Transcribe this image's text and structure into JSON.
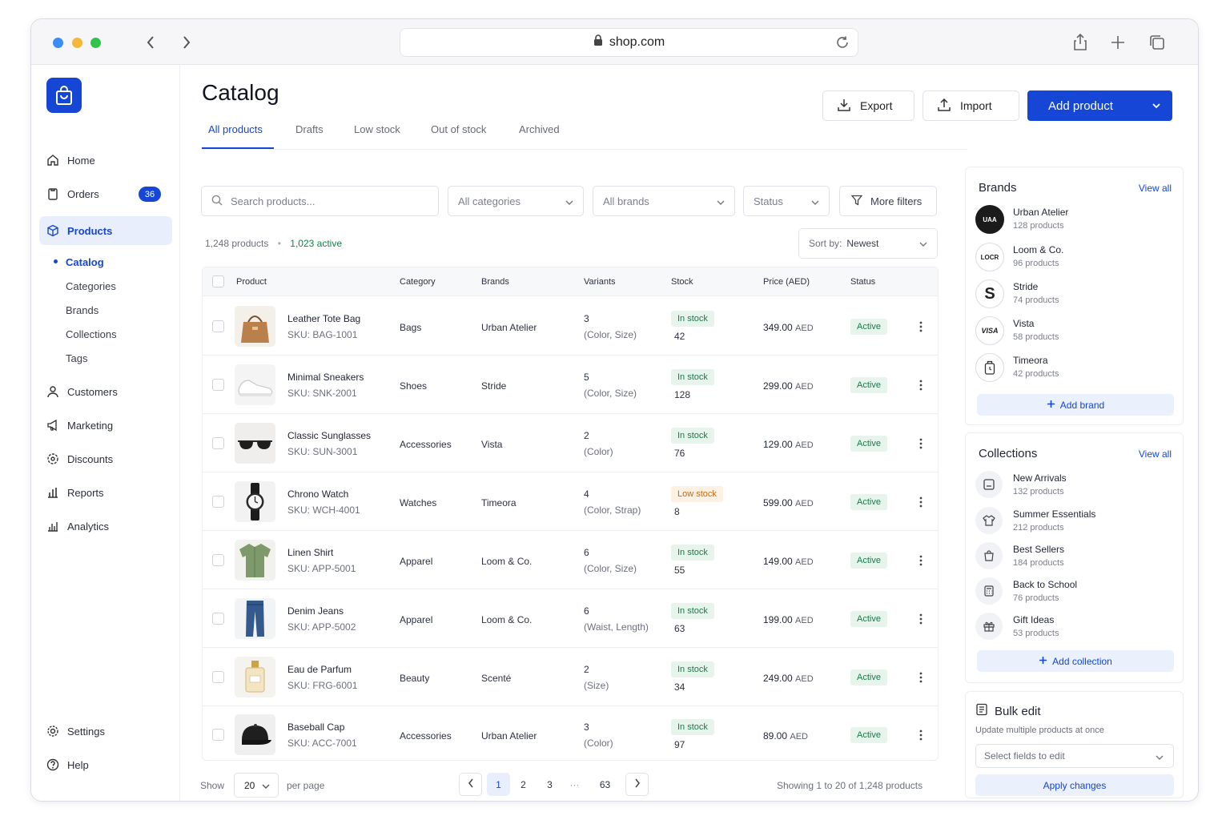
{
  "browser": {
    "url": "shop.com"
  },
  "colors": {
    "accent": "#1546d6",
    "success": "#1a7a48",
    "warning": "#c76a12"
  },
  "sidebar": {
    "nav": [
      {
        "label": "Home",
        "icon": "home-icon"
      },
      {
        "label": "Orders",
        "icon": "clipboard-icon",
        "badge": "36"
      },
      {
        "label": "Products",
        "icon": "box-icon",
        "active": true
      },
      {
        "label": "Customers",
        "icon": "user-icon"
      },
      {
        "label": "Marketing",
        "icon": "megaphone-icon"
      },
      {
        "label": "Discounts",
        "icon": "gear-discount-icon"
      },
      {
        "label": "Reports",
        "icon": "bar-chart-icon"
      },
      {
        "label": "Analytics",
        "icon": "analytics-icon"
      }
    ],
    "sub": [
      "Catalog",
      "Categories",
      "Brands",
      "Collections",
      "Tags"
    ],
    "footer": [
      {
        "label": "Settings",
        "icon": "settings-icon"
      },
      {
        "label": "Help",
        "icon": "help-icon"
      }
    ]
  },
  "header": {
    "title": "Catalog",
    "export_label": "Export",
    "import_label": "Import",
    "add_label": "Add product"
  },
  "tabs": [
    "All products",
    "Drafts",
    "Low stock",
    "Out of stock",
    "Archived"
  ],
  "filters": {
    "search_placeholder": "Search products...",
    "category": "All categories",
    "brand": "All brands",
    "status": "Status",
    "more": "More filters"
  },
  "summary": {
    "total": "1,248 products",
    "sep": "•",
    "active": "1,023 active"
  },
  "sort": {
    "label": "Sort by:",
    "value": "Newest"
  },
  "table": {
    "headers": [
      "Product",
      "Category",
      "Brands",
      "Variants",
      "Stock",
      "Price (AED)",
      "Status"
    ],
    "rows": [
      {
        "name": "Leather Tote Bag",
        "sku": "SKU: BAG-1001",
        "category": "Bags",
        "brand": "Urban Atelier",
        "variants": "3",
        "variant_detail": "(Color, Size)",
        "stock_label": "In stock",
        "stock": "42",
        "price": "349.00",
        "currency": "AED",
        "status": "Active"
      },
      {
        "name": "Minimal Sneakers",
        "sku": "SKU: SNK-2001",
        "category": "Shoes",
        "brand": "Stride",
        "variants": "5",
        "variant_detail": "(Color, Size)",
        "stock_label": "In stock",
        "stock": "128",
        "price": "299.00",
        "currency": "AED",
        "status": "Active"
      },
      {
        "name": "Classic Sunglasses",
        "sku": "SKU: SUN-3001",
        "category": "Accessories",
        "brand": "Vista",
        "variants": "2",
        "variant_detail": "(Color)",
        "stock_label": "In stock",
        "stock": "76",
        "price": "129.00",
        "currency": "AED",
        "status": "Active"
      },
      {
        "name": "Chrono Watch",
        "sku": "SKU: WCH-4001",
        "category": "Watches",
        "brand": "Timeora",
        "variants": "4",
        "variant_detail": "(Color, Strap)",
        "stock_label": "Low stock",
        "stock": "8",
        "price": "599.00",
        "currency": "AED",
        "status": "Active"
      },
      {
        "name": "Linen Shirt",
        "sku": "SKU: APP-5001",
        "category": "Apparel",
        "brand": "Loom & Co.",
        "variants": "6",
        "variant_detail": "(Color, Size)",
        "stock_label": "In stock",
        "stock": "55",
        "price": "149.00",
        "currency": "AED",
        "status": "Active"
      },
      {
        "name": "Denim Jeans",
        "sku": "SKU: APP-5002",
        "category": "Apparel",
        "brand": "Loom & Co.",
        "variants": "6",
        "variant_detail": "(Waist, Length)",
        "stock_label": "In stock",
        "stock": "63",
        "price": "199.00",
        "currency": "AED",
        "status": "Active"
      },
      {
        "name": "Eau de Parfum",
        "sku": "SKU: FRG-6001",
        "category": "Beauty",
        "brand": "Scenté",
        "variants": "2",
        "variant_detail": "(Size)",
        "stock_label": "In stock",
        "stock": "34",
        "price": "249.00",
        "currency": "AED",
        "status": "Active"
      },
      {
        "name": "Baseball Cap",
        "sku": "SKU: ACC-7001",
        "category": "Accessories",
        "brand": "Urban Atelier",
        "variants": "3",
        "variant_detail": "(Color)",
        "stock_label": "In stock",
        "stock": "97",
        "price": "89.00",
        "currency": "AED",
        "status": "Active"
      }
    ]
  },
  "pagination": {
    "show_label": "Show",
    "per_page": "20",
    "per_page_label": "per page",
    "pages": [
      "1",
      "2",
      "3",
      "···",
      "63"
    ],
    "current": "1",
    "showing": "Showing 1 to 20 of 1,248 products"
  },
  "brands_panel": {
    "title": "Brands",
    "view_all": "View all",
    "items": [
      {
        "logo": "UAA",
        "name": "Urban Atelier",
        "count": "128 products"
      },
      {
        "logo": "LOCR",
        "name": "Loom & Co.",
        "count": "96 products"
      },
      {
        "logo": "S",
        "name": "Stride",
        "count": "74 products"
      },
      {
        "logo": "VISA",
        "name": "Vista",
        "count": "58 products"
      },
      {
        "logo": "",
        "name": "Timeora",
        "count": "42 products"
      }
    ],
    "add_label": "Add brand"
  },
  "collections_panel": {
    "title": "Collections",
    "view_all": "View all",
    "items": [
      {
        "name": "New Arrivals",
        "count": "132 products"
      },
      {
        "name": "Summer Essentials",
        "count": "212 products"
      },
      {
        "name": "Best Sellers",
        "count": "184 products"
      },
      {
        "name": "Back to School",
        "count": "76 products"
      },
      {
        "name": "Gift Ideas",
        "count": "53 products"
      }
    ],
    "add_label": "Add collection"
  },
  "bulk_panel": {
    "title": "Bulk edit",
    "subtitle": "Update multiple products at once",
    "select_placeholder": "Select fields to edit",
    "apply_label": "Apply changes"
  }
}
